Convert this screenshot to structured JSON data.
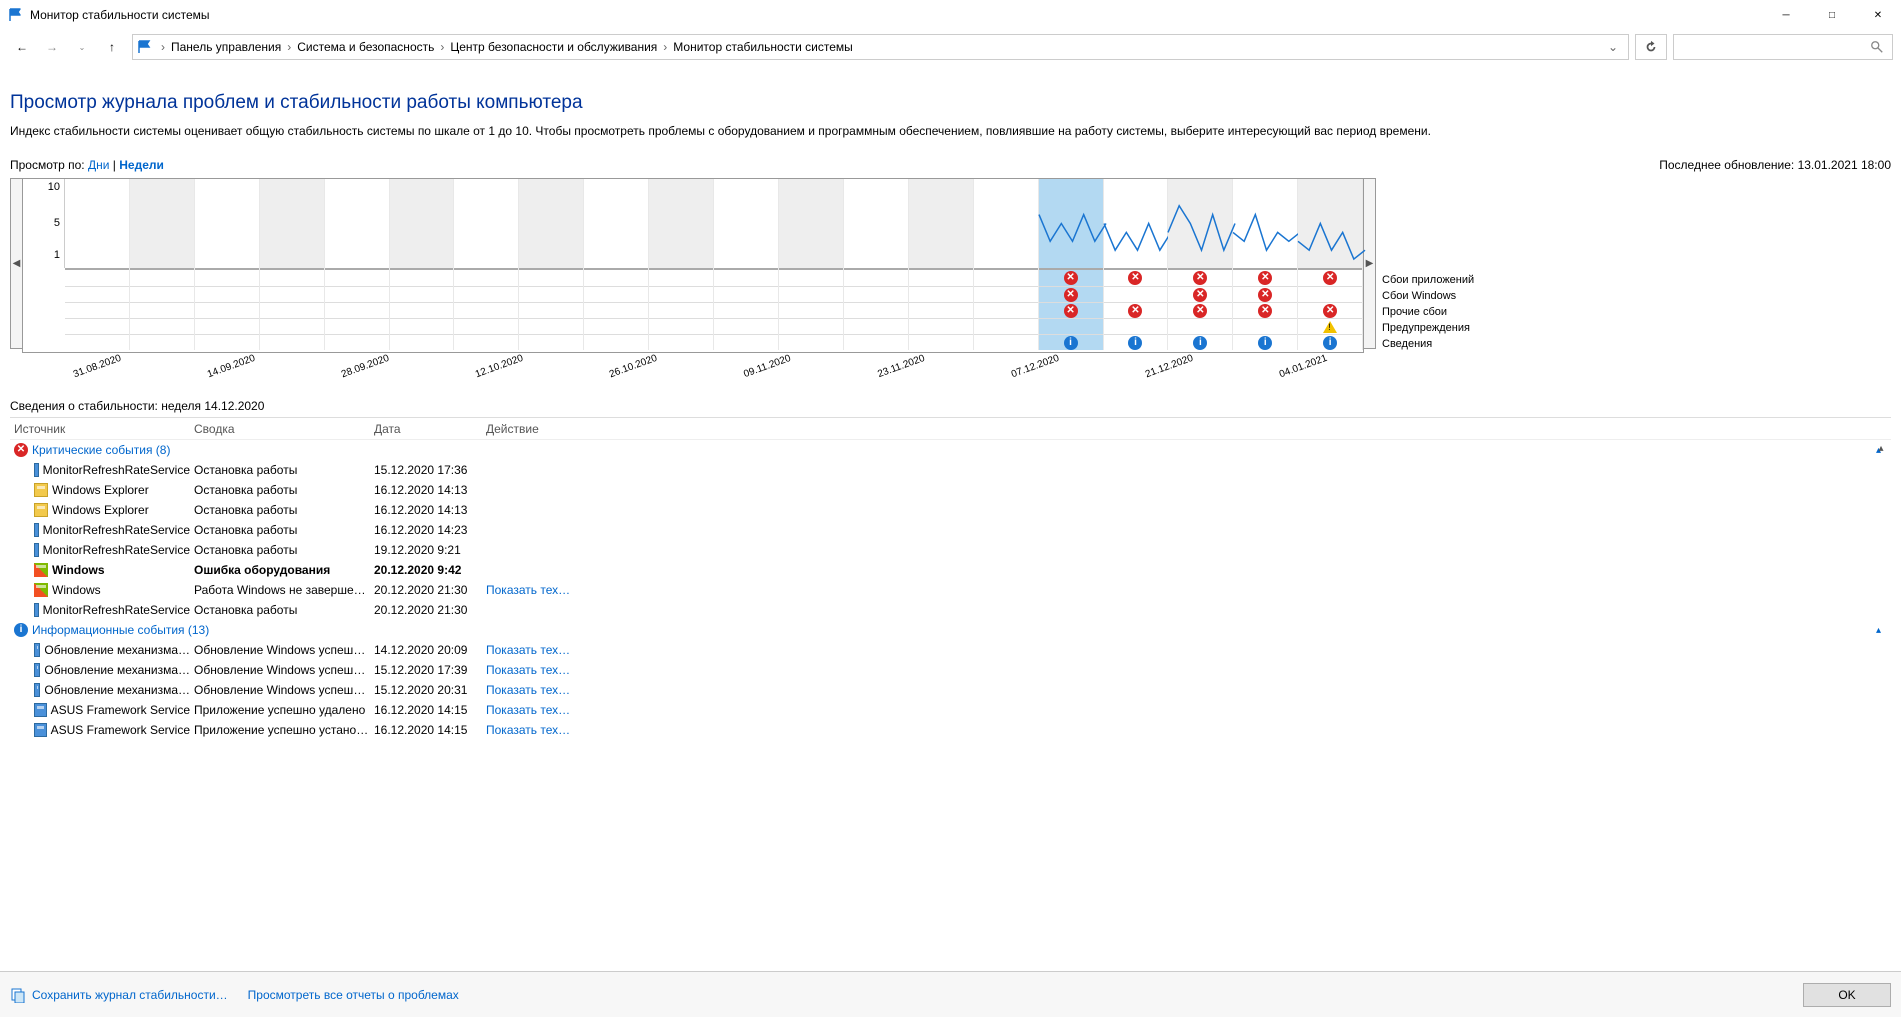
{
  "window": {
    "title": "Монитор стабильности системы"
  },
  "breadcrumb": [
    "Панель управления",
    "Система и безопасность",
    "Центр безопасности и обслуживания",
    "Монитор стабильности системы"
  ],
  "page_title": "Просмотр журнала проблем и стабильности работы компьютера",
  "description": "Индекс стабильности системы оценивает общую стабильность системы по шкале от 1 до 10. Чтобы просмотреть проблемы с оборудованием и программным обеспечением, повлиявшие на работу системы, выберите интересующий вас период времени.",
  "view_by": {
    "label": "Просмотр по:",
    "days": "Дни",
    "sep": " | ",
    "weeks": "Недели"
  },
  "last_update": "Последнее обновление: 13.01.2021 18:00",
  "chart_data": {
    "type": "line",
    "y_ticks": [
      10,
      5,
      1
    ],
    "ylim": [
      1,
      10
    ],
    "x_dates": [
      "31.08.2020",
      "",
      "14.09.2020",
      "",
      "28.09.2020",
      "",
      "12.10.2020",
      "",
      "26.10.2020",
      "",
      "09.11.2020",
      "",
      "23.11.2020",
      "",
      "07.12.2020",
      "",
      "21.12.2020",
      "",
      "04.01.2021",
      ""
    ],
    "selected_col": 15,
    "stability_index": {
      "15": [
        6,
        3,
        5,
        3,
        6,
        3,
        5
      ],
      "16": [
        5,
        2,
        4,
        2,
        5,
        2,
        4
      ],
      "17": [
        4,
        7,
        5,
        2,
        6,
        2,
        5
      ],
      "18": [
        4,
        3,
        6,
        2,
        4,
        3,
        4
      ],
      "19": [
        3,
        2,
        5,
        2,
        4,
        1,
        2
      ]
    },
    "legend": [
      "Сбои приложений",
      "Сбои Windows",
      "Прочие сбои",
      "Предупреждения",
      "Сведения"
    ],
    "events": {
      "15": {
        "app_fail": true,
        "win_fail": true,
        "other": true,
        "warn": false,
        "info": true
      },
      "16": {
        "app_fail": true,
        "win_fail": false,
        "other": true,
        "warn": false,
        "info": true
      },
      "17": {
        "app_fail": true,
        "win_fail": true,
        "other": true,
        "warn": false,
        "info": true
      },
      "18": {
        "app_fail": true,
        "win_fail": true,
        "other": true,
        "warn": false,
        "info": true
      },
      "19": {
        "app_fail": true,
        "win_fail": false,
        "other": true,
        "warn": true,
        "info": true
      }
    }
  },
  "details_title": "Сведения о стабильности: неделя 14.12.2020",
  "columns": {
    "source": "Источник",
    "summary": "Сводка",
    "date": "Дата",
    "action": "Действие"
  },
  "groups": {
    "critical": "Критические события (8)",
    "info": "Информационные события (13)"
  },
  "critical_events": [
    {
      "icon": "app",
      "source": "MonitorRefreshRateService",
      "summary": "Остановка работы",
      "date": "15.12.2020 17:36",
      "action": "",
      "bold": false
    },
    {
      "icon": "explorer",
      "source": "Windows Explorer",
      "summary": "Остановка работы",
      "date": "16.12.2020 14:13",
      "action": "",
      "bold": false
    },
    {
      "icon": "explorer",
      "source": "Windows Explorer",
      "summary": "Остановка работы",
      "date": "16.12.2020 14:13",
      "action": "",
      "bold": false
    },
    {
      "icon": "app",
      "source": "MonitorRefreshRateService",
      "summary": "Остановка работы",
      "date": "16.12.2020 14:23",
      "action": "",
      "bold": false
    },
    {
      "icon": "app",
      "source": "MonitorRefreshRateService",
      "summary": "Остановка работы",
      "date": "19.12.2020 9:21",
      "action": "",
      "bold": false
    },
    {
      "icon": "win",
      "source": "Windows",
      "summary": "Ошибка оборудования",
      "date": "20.12.2020 9:42",
      "action": "",
      "bold": true
    },
    {
      "icon": "win",
      "source": "Windows",
      "summary": "Работа Windows не завершен…",
      "date": "20.12.2020 21:30",
      "action": "Показать тех…",
      "bold": false
    },
    {
      "icon": "app",
      "source": "MonitorRefreshRateService",
      "summary": "Остановка работы",
      "date": "20.12.2020 21:30",
      "action": "",
      "bold": false
    }
  ],
  "info_events": [
    {
      "icon": "app",
      "source": "Обновление механизма…",
      "summary": "Обновление Windows успешн…",
      "date": "14.12.2020 20:09",
      "action": "Показать тех…"
    },
    {
      "icon": "app",
      "source": "Обновление механизма…",
      "summary": "Обновление Windows успешн…",
      "date": "15.12.2020 17:39",
      "action": "Показать тех…"
    },
    {
      "icon": "app",
      "source": "Обновление механизма…",
      "summary": "Обновление Windows успешн…",
      "date": "15.12.2020 20:31",
      "action": "Показать тех…"
    },
    {
      "icon": "app",
      "source": "ASUS Framework Service",
      "summary": "Приложение успешно удалено",
      "date": "16.12.2020 14:15",
      "action": "Показать тех…"
    },
    {
      "icon": "app",
      "source": "ASUS Framework Service",
      "summary": "Приложение успешно установ…",
      "date": "16.12.2020 14:15",
      "action": "Показать тех…"
    }
  ],
  "footer": {
    "save": "Сохранить журнал стабильности…",
    "view_all": "Просмотреть все отчеты о проблемах",
    "ok": "OK"
  }
}
